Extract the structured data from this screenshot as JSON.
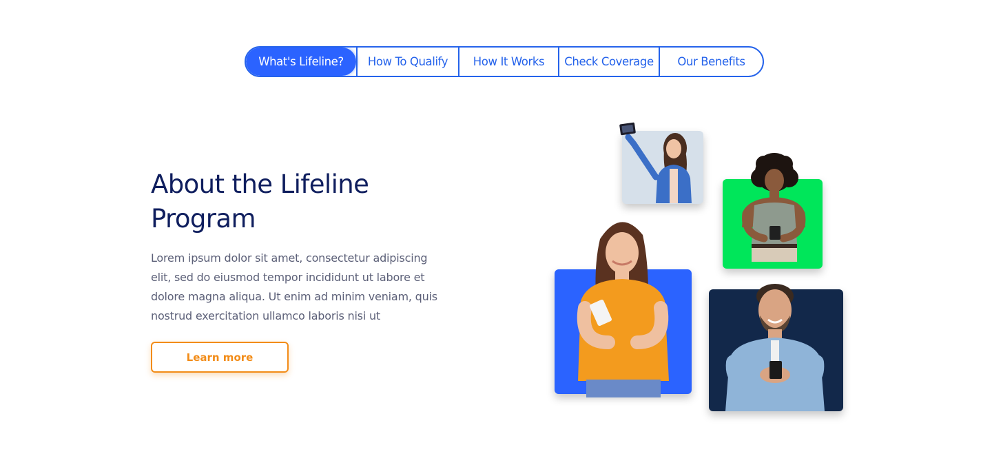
{
  "nav": {
    "tabs": [
      {
        "label": "What's Lifeline?",
        "active": true
      },
      {
        "label": "How To Qualify",
        "active": false
      },
      {
        "label": "How It Works",
        "active": false
      },
      {
        "label": "Check Coverage",
        "active": false
      },
      {
        "label": "Our Benefits",
        "active": false
      }
    ]
  },
  "hero": {
    "heading_line1": "About the Lifeline",
    "heading_line2": "Program",
    "body": "Lorem ipsum dolor sit amet, consectetur adipiscing elit, sed do eiusmod tempor incididunt ut labore et dolore magna aliqua. Ut enim ad minim veniam, quis nostrud exercitation ullamco laboris nisi ut",
    "cta_label": "Learn more"
  },
  "colors": {
    "primary": "#2b63ff",
    "heading": "#0f1e5e",
    "body": "#5c6078",
    "accent": "#f28c18",
    "card_green": "#00e65a",
    "card_blue": "#2b63ff",
    "card_navy": "#12284a",
    "card_grey": "#d6e0ea"
  }
}
